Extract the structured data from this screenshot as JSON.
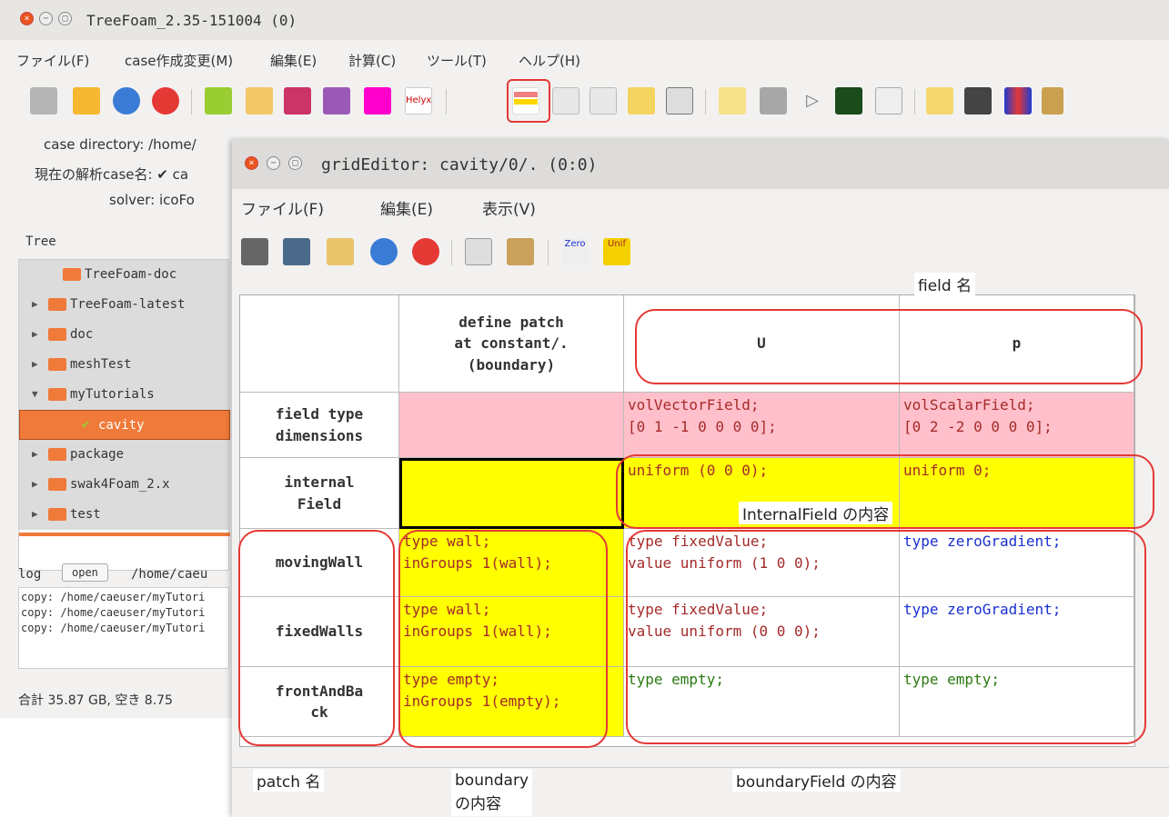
{
  "main": {
    "title": "TreeFoam_2.35-151004 (0)",
    "menu": [
      "ファイル(F)",
      "case作成変更(M)",
      "編集(E)",
      "計算(C)",
      "ツール(T)",
      "ヘルプ(H)"
    ],
    "case_dir_label": "case directory: /home/",
    "current_case_label": "現在の解析case名: ✔ ca",
    "solver_label": "solver: icoFo",
    "tree_header": "Tree",
    "log_label": "log",
    "log_open": "open",
    "log_path": "/home/caeu",
    "log_lines": [
      "copy: /home/caeuser/myTutori",
      "copy: /home/caeuser/myTutori",
      "copy: /home/caeuser/myTutori"
    ],
    "status": "合計 35.87 GB, 空き 8.75"
  },
  "tree": [
    "TreeFoam-doc",
    "TreeFoam-latest",
    "doc",
    "meshTest",
    "myTutorials",
    "cavity",
    "package",
    "swak4Foam_2.x",
    "test"
  ],
  "editor": {
    "title": "gridEditor: cavity/0/. (0:0)",
    "menu": [
      "ファイル(F)",
      "編集(E)",
      "表示(V)"
    ]
  },
  "grid": {
    "col_headers": [
      "define patch\nat constant/.\n(boundary)",
      "U",
      "p"
    ],
    "rows": [
      {
        "label": "field type\ndimensions",
        "cells": [
          "volVectorField;\n[0 1 -1 0 0 0 0];",
          "volScalarField;\n[0 2 -2 0 0 0 0];"
        ]
      },
      {
        "label": "internal\nField",
        "cells": [
          "uniform (0 0 0);",
          "uniform 0;"
        ]
      },
      {
        "label": "movingWall",
        "cells": [
          "type wall;\ninGroups 1(wall);",
          "type fixedValue;\nvalue uniform (1 0 0);",
          "type zeroGradient;"
        ]
      },
      {
        "label": "fixedWalls",
        "cells": [
          "type wall;\ninGroups 1(wall);",
          "type fixedValue;\nvalue uniform (0 0 0);",
          "type zeroGradient;"
        ]
      },
      {
        "label": "frontAndBa\nck",
        "cells": [
          "type empty;\ninGroups 1(empty);",
          "type empty;",
          "type empty;"
        ]
      }
    ]
  },
  "annotations": {
    "field_name": "field 名",
    "internal_field": "InternalField の内容",
    "patch_name": "patch 名",
    "boundary_line1": "boundary",
    "boundary_line2": "の内容",
    "boundary_field": "boundaryField の内容"
  },
  "colors": {
    "accent": "#f07a3a",
    "highlight": "#e53935",
    "pink": "#ffc0cb",
    "yellow": "#ffff00"
  }
}
